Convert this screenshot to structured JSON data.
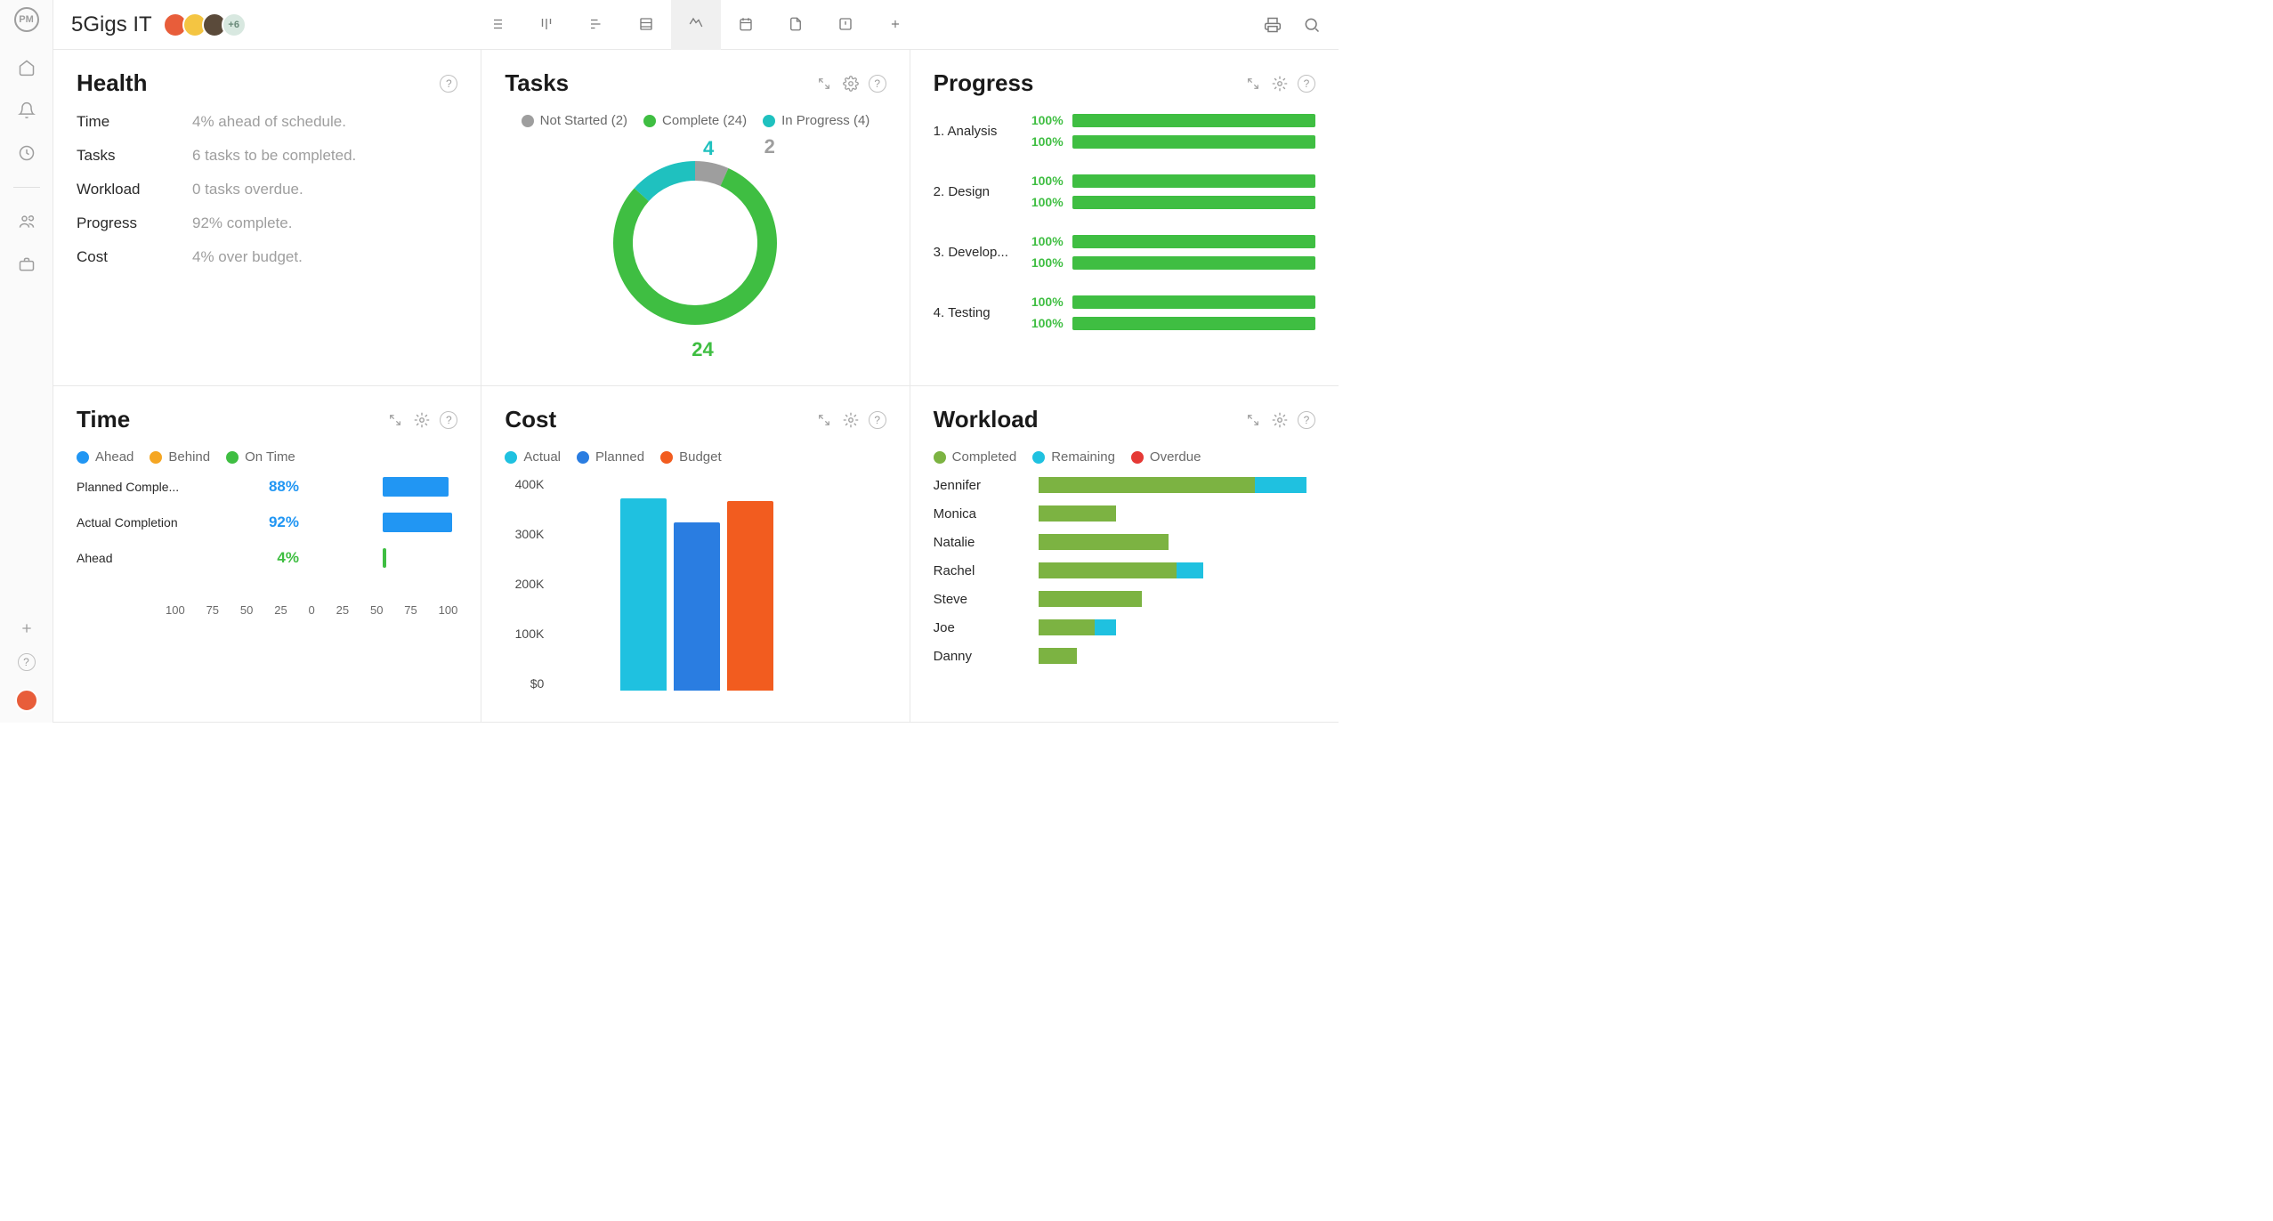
{
  "project_title": "5Gigs IT",
  "avatar_more": "+6",
  "panels": {
    "health": {
      "title": "Health",
      "rows": [
        {
          "label": "Time",
          "value": "4% ahead of schedule."
        },
        {
          "label": "Tasks",
          "value": "6 tasks to be completed."
        },
        {
          "label": "Workload",
          "value": "0 tasks overdue."
        },
        {
          "label": "Progress",
          "value": "92% complete."
        },
        {
          "label": "Cost",
          "value": "4% over budget."
        }
      ]
    },
    "tasks": {
      "title": "Tasks",
      "legend": [
        {
          "label": "Not Started (2)",
          "color": "#9e9e9e"
        },
        {
          "label": "Complete (24)",
          "color": "#3fbe42"
        },
        {
          "label": "In Progress (4)",
          "color": "#1fc1bf"
        }
      ],
      "chart_data": {
        "type": "pie",
        "categories": [
          "Not Started",
          "Complete",
          "In Progress"
        ],
        "values": [
          2,
          24,
          4
        ],
        "colors": [
          "#9e9e9e",
          "#3fbe42",
          "#1fc1bf"
        ],
        "data_labels": [
          "2",
          "24",
          "4"
        ]
      }
    },
    "progress": {
      "title": "Progress",
      "rows": [
        {
          "label": "1. Analysis",
          "bars": [
            100,
            100
          ]
        },
        {
          "label": "2. Design",
          "bars": [
            100,
            100
          ]
        },
        {
          "label": "3. Develop...",
          "bars": [
            100,
            100
          ]
        },
        {
          "label": "4. Testing",
          "bars": [
            100,
            100
          ]
        }
      ]
    },
    "time": {
      "title": "Time",
      "legend": [
        {
          "label": "Ahead",
          "color": "#2196f3"
        },
        {
          "label": "Behind",
          "color": "#f5a623"
        },
        {
          "label": "On Time",
          "color": "#3fbe42"
        }
      ],
      "chart_data": {
        "type": "bar",
        "categories": [
          "Planned Comple...",
          "Actual Completion",
          "Ahead"
        ],
        "values": [
          88,
          92,
          4
        ],
        "colors": [
          "#2196f3",
          "#2196f3",
          "#3fbe42"
        ],
        "xlabel": "",
        "ylabel": "",
        "xlim": [
          -100,
          100
        ],
        "ticks": [
          "100",
          "75",
          "50",
          "25",
          "0",
          "25",
          "50",
          "75",
          "100"
        ]
      }
    },
    "cost": {
      "title": "Cost",
      "legend": [
        {
          "label": "Actual",
          "color": "#1fc1e0"
        },
        {
          "label": "Planned",
          "color": "#2a7de1"
        },
        {
          "label": "Budget",
          "color": "#f25c1f"
        }
      ],
      "chart_data": {
        "type": "bar",
        "categories": [
          "Actual",
          "Planned",
          "Budget"
        ],
        "values": [
          360000,
          315000,
          355000
        ],
        "colors": [
          "#1fc1e0",
          "#2a7de1",
          "#f25c1f"
        ],
        "ylabel": "",
        "xlabel": "",
        "ylim": [
          0,
          400000
        ],
        "yticks": [
          "400K",
          "300K",
          "200K",
          "100K",
          "$0"
        ]
      }
    },
    "workload": {
      "title": "Workload",
      "legend": [
        {
          "label": "Completed",
          "color": "#7cb342"
        },
        {
          "label": "Remaining",
          "color": "#1fc1e0"
        },
        {
          "label": "Overdue",
          "color": "#e53935"
        }
      ],
      "chart_data": {
        "type": "bar",
        "categories": [
          "Jennifer",
          "Monica",
          "Natalie",
          "Rachel",
          "Steve",
          "Joe",
          "Danny"
        ],
        "series": [
          {
            "name": "Completed",
            "values": [
              50,
              18,
              30,
              32,
              24,
              13,
              9
            ]
          },
          {
            "name": "Remaining",
            "values": [
              12,
              0,
              0,
              6,
              0,
              5,
              0
            ]
          },
          {
            "name": "Overdue",
            "values": [
              0,
              0,
              0,
              0,
              0,
              0,
              0
            ]
          }
        ]
      }
    }
  }
}
